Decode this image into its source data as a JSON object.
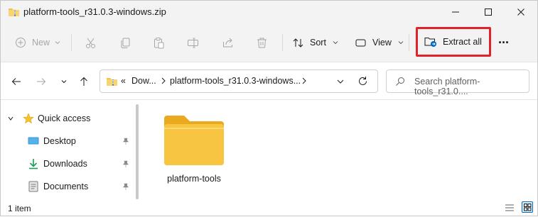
{
  "window": {
    "title": "platform-tools_r31.0.3-windows.zip",
    "controls": [
      "minimize-icon",
      "maximize-icon",
      "close-icon"
    ]
  },
  "toolbar": {
    "new_label": "New",
    "sort_label": "Sort",
    "view_label": "View",
    "extract_label": "Extract all",
    "more_label": "···",
    "highlight_color": "#e0232a"
  },
  "address": {
    "overflow": "«",
    "segments": [
      "Dow...",
      "platform-tools_r31.0.3-windows..."
    ]
  },
  "search": {
    "placeholder": "Search platform-tools_r31.0...."
  },
  "sidebar": {
    "items": [
      {
        "label": "Quick access",
        "icon": "star-icon"
      },
      {
        "label": "Desktop",
        "icon": "desktop-icon",
        "pinned": true
      },
      {
        "label": "Downloads",
        "icon": "download-icon",
        "pinned": true
      },
      {
        "label": "Documents",
        "icon": "document-icon",
        "pinned": true
      }
    ]
  },
  "files": [
    {
      "name": "platform-tools",
      "type": "folder"
    }
  ],
  "status": {
    "count": "1 item"
  },
  "colors": {
    "folder": "#f8c542",
    "accent": "#0067c0"
  }
}
